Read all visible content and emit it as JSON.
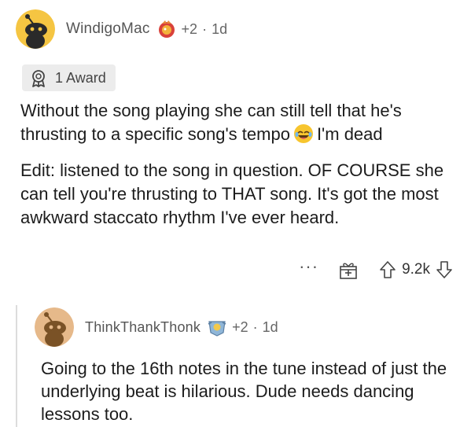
{
  "comment": {
    "username": "WindigoMac",
    "score_delta": "+2",
    "separator": "·",
    "age": "1d",
    "award_label": "1 Award",
    "body_p1_a": "Without the song playing she can still tell that he's thrusting to a specific song's tempo",
    "body_p1_b": "I'm dead",
    "body_p2": "Edit: listened to the song in question. OF COURSE she can tell you're thrusting to THAT song. It's got the most awkward staccato rhythm I've ever heard.",
    "more_label": "···",
    "vote_count": "9.2k"
  },
  "reply": {
    "username": "ThinkThankThonk",
    "score_delta": "+2",
    "separator": "·",
    "age": "1d",
    "body": "Going to the 16th notes in the tune instead of just the underlying beat is hilarious. Dude needs dancing lessons too."
  },
  "colors": {
    "avatar_bg": "#F5C542",
    "avatar_bg_reply": "#E6B98A",
    "award_pill_bg": "#ECECEC",
    "text": "#1C1C1C",
    "muted": "#555555"
  },
  "icons": [
    "snoo-avatar-icon",
    "award-flair-icon",
    "award-badge-icon",
    "laughing-emoji-icon",
    "more-icon",
    "gift-icon",
    "upvote-icon",
    "downvote-icon"
  ]
}
